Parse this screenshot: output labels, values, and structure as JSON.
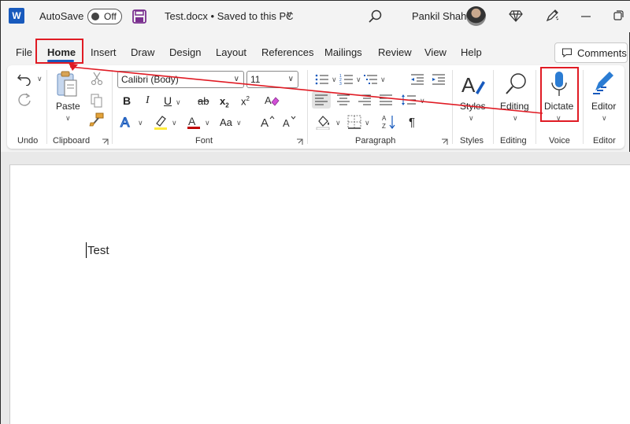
{
  "app": {
    "logo_letter": "W"
  },
  "titlebar": {
    "autosave_label": "AutoSave",
    "autosave_state": "Off",
    "document_title": "Test.docx • Saved to this PC",
    "user_name": "Pankil Shah"
  },
  "tabs": [
    "File",
    "Home",
    "Insert",
    "Draw",
    "Design",
    "Layout",
    "References",
    "Mailings",
    "Review",
    "View",
    "Help"
  ],
  "active_tab": "Home",
  "comments_label": "Comments",
  "ribbon": {
    "font_name": "Calibri (Body)",
    "font_size": "11",
    "paste_label": "Paste",
    "styles_label": "Styles",
    "editing_label": "Editing",
    "dictate_label": "Dictate",
    "editor_label": "Editor",
    "groups": {
      "undo": "Undo",
      "clipboard": "Clipboard",
      "font": "Font",
      "paragraph": "Paragraph",
      "styles": "Styles",
      "editing": "Editing",
      "voice": "Voice",
      "editor": "Editor"
    },
    "font_buttons": {
      "bold": "B",
      "italic": "I",
      "underline": "U",
      "strike": "ab",
      "subscript": "x",
      "superscript": "x",
      "change_case": "Aa"
    }
  },
  "document": {
    "text": "Test"
  },
  "colors": {
    "accent": "#185abd",
    "highlight_box": "#e01b24",
    "font_color": "#c00000",
    "highlighter": "#ffeb3b"
  }
}
